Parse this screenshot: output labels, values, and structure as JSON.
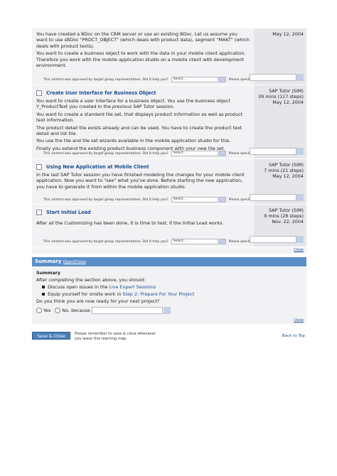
{
  "sections": [
    {
      "paragraphs": [
        "You have created a BDoc on the CRM server or use an existing BDoc. Let us assume you want to use sBDoc \"PRDCT_OBJECT\" (which deals with product data), segment \"MAKT\" (which deals with product texts).",
        "You want to create a business object to work with the data in your mobile client application. Therefore you work with the mobile application studio on a mobile client with development environment."
      ],
      "side": [
        "May 12, 2004"
      ]
    },
    {
      "title": "Create User Interface for Business Object",
      "paragraphs": [
        "You want to create a user interface for a business object. You use the business object Y_ProductText you created in the previous SAP Tutor session.",
        "You want to create a standard tile set, that displays product information as well as product text information.",
        "The product detail tile exists already and can be used. You have to create the product text detail and list tile.",
        "You use the tile and tile set wizards available in the mobile application studio for this.",
        "Finally you extend the existing product business component with your new tile set."
      ],
      "side": [
        "SAP Tutor (SIM)",
        "39 mins (117 steps)",
        "May 12, 2004"
      ]
    },
    {
      "title": "Using New Application at Mobile Client",
      "paragraphs": [
        "In the last SAP Tutor session you have finished modeling the changes for your mobile client application. Now you want to \"see\" what you've done. Before starting the new application, you have to generate it from within the mobile application studio."
      ],
      "side": [
        "SAP Tutor (SIM)",
        "7 mins (21 steps)",
        "May 12, 2004"
      ]
    },
    {
      "title": "Start Initial Load",
      "paragraphs": [
        "After all the Customizing has been done, it is time to test, if the Initial Load works."
      ],
      "side": [
        "SAP Tutor (SIM)",
        "9 mins (28 steps)",
        "Nov. 22, 2004"
      ]
    }
  ],
  "approval": {
    "text": "This content was approved by target group representatives. Did it help you?",
    "select": "Select...",
    "specify": "Please specify:"
  },
  "close_label": "Close",
  "summary": {
    "header": "Summary",
    "open_close": "Open/Close",
    "title": "Summary",
    "intro": "After completing the section above, you should:",
    "bullet1_pre": "Discuss open issues in the ",
    "bullet1_link": "Live Expert Sessions",
    "bullet2_pre": "Equip yourself for onsite work in ",
    "bullet2_link": "Step 2: Prepare For Your Project",
    "question": "Do you think you are now ready for your next project?",
    "yes": "Yes",
    "no": "No, because"
  },
  "footer": {
    "save": "Save & Close",
    "remember_line1": "Please remember to save & close whenever",
    "remember_line2": "you leave this learning map.",
    "back": "Back to Top"
  }
}
